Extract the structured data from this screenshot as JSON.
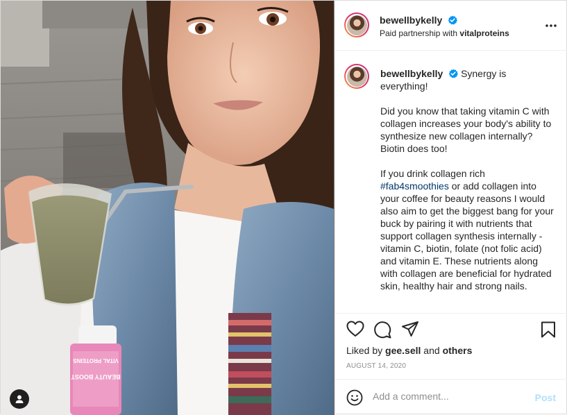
{
  "post": {
    "username": "bewellbykelly",
    "partnership_prefix": "Paid partnership with ",
    "partner": "vitalproteins",
    "more_icon": "more-horizontal-icon",
    "verified_icon": "verified-badge-icon",
    "caption": {
      "username": "bewellbykelly",
      "first_line": "Synergy is everything!",
      "paragraph2": "Did you know that taking vitamin C with collagen increases your body's ability to synthesize new collagen internally? Biotin does too!",
      "p3_before": "If you drink collagen rich ",
      "hashtag": "#fab4smoothies",
      "p3_after": " or add collagen into your coffee for beauty reasons I would also aim to get the biggest bang for your buck by pairing it with nutrients that support collagen synthesis internally - vitamin C, biotin, folate (not folic acid) and vitamin E. These nutrients along with collagen are beneficial for hydrated skin, healthy hair and strong nails."
    },
    "likes": {
      "prefix": "Liked by ",
      "user": "gee.sell",
      "middle": " and ",
      "others": "others"
    },
    "date": "AUGUST 14, 2020",
    "comment": {
      "placeholder": "Add a comment...",
      "post_label": "Post"
    },
    "colors": {
      "accent_blue": "#0095f6",
      "post_disabled": "#b2dffc",
      "hashtag": "#00376b",
      "muted": "#8e8e8e"
    },
    "image": {
      "bottle_brand": "VITAL PROTEINS",
      "bottle_product": "BEAUTY BOOST"
    }
  }
}
